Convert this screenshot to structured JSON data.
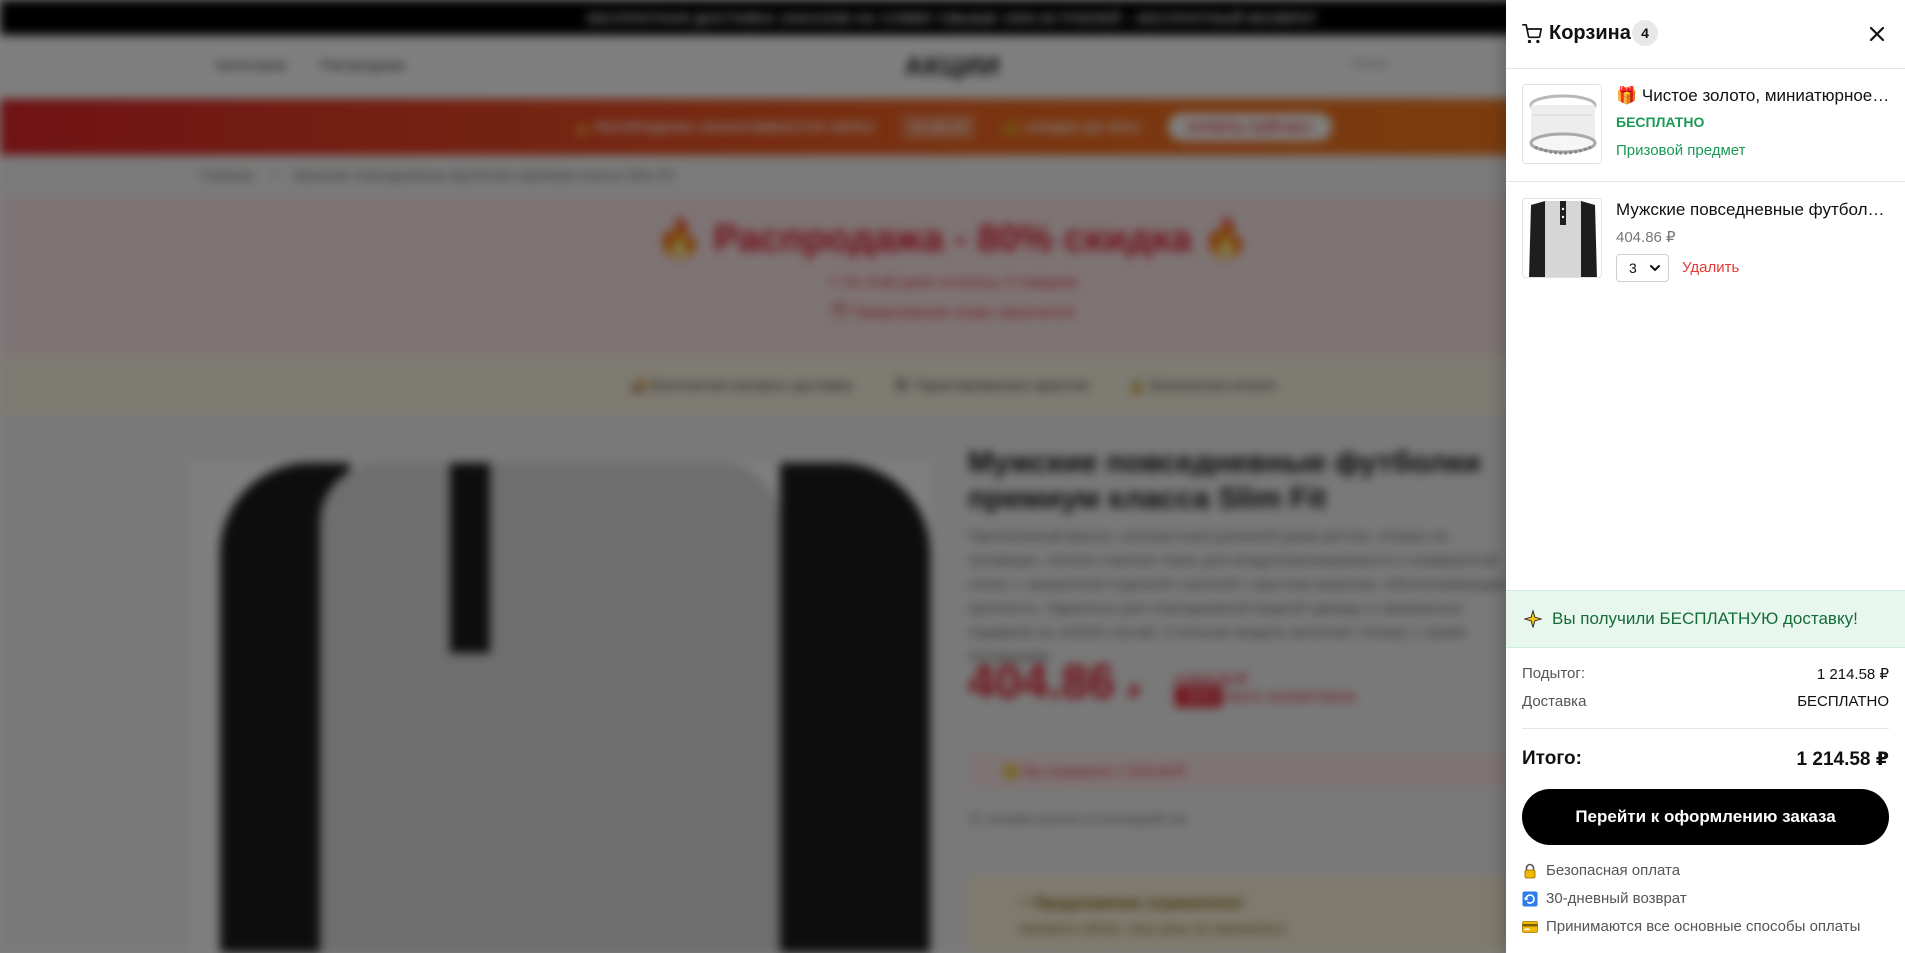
{
  "background": {
    "topbar_text": "БЕСПЛАТНАЯ ДОСТАВКА ЗАКАЗОВ НА СУММУ СВЫШЕ 1500.00 РУБЛЕЙ – БЕСПЛАТНЫЙ ВОЗВРАТ",
    "nav": {
      "categories": "Категории",
      "sales": "Распродажи",
      "logo": "АКЦИИ",
      "search": "Поиск"
    },
    "promo": {
      "ends": "🔥 РАСПРОДАЖА ЗАКАНЧИВАЕТСЯ ЧЕРЕЗ",
      "timer": "11:39:18",
      "discount": "💰 СКИДКИ ДО 80%!",
      "cta": "КУПИТЬ СЕЙЧАС!"
    },
    "breadcrumb": {
      "home": "Главная",
      "sep": "/",
      "current": "Мужские повседневные футболки премиум класса Slim Fit"
    },
    "sale": {
      "heading": "🔥 Распродажа - 80% скидка 🔥",
      "line1": "⚡ По этой цене осталось 5 товаров!",
      "line2": "⏰ Предложение скоро закончится"
    },
    "benefits": [
      "🚚 Бесплатная экспресс доставка",
      "🛡 Гарантированная гарантия",
      "🔒 Безопасная оплата"
    ],
    "product": {
      "title": "Мужские повседневные футболки премиум класса Slim Fit",
      "desc": "Приталенный фасон, контрастный длинный рукав реглан, планка на пуговицах, легкая и мягкая ткань для воздухопроницаемости и комфортной носки, с аккуратной отделкой строчкой с круглым вырезом, обеспечивающим прочность. Идеально для повседневной модной одежды и прекрасных подарков на любой случай. Стильная модель включает планку с тремя пуговицами.",
      "price": "404.86",
      "currency": "₽",
      "old_price": "2 024.32 ₽",
      "badge": "-80%",
      "stock": "мало экземпляров",
      "savings": "🪙 Вы сохраните 1 619.46 ₽",
      "viewers": "21 человек купили за последний час",
      "limited_title": "⚡ Предложение ограничено!",
      "limited_text": "Закажите сейчас, пока цены не изменились!"
    }
  },
  "cart": {
    "title": "Корзина",
    "count": "4",
    "items": [
      {
        "name": "🎁 Чистое золото, миниатюрное кольцо",
        "price_label": "БЕСПЛАТНО",
        "tag": "Призовой предмет"
      },
      {
        "name": "Мужские повседневные футболки премиум класса Slim Fit",
        "price": "404.86 ₽",
        "qty": "3",
        "remove_label": "Удалить"
      }
    ],
    "shipping_banner": "Вы получили БЕСПЛАТНУЮ доставку!",
    "subtotal_label": "Подытог:",
    "subtotal_value": "1 214.58 ₽",
    "delivery_label": "Доставка",
    "delivery_value": "БЕСПЛАТНО",
    "total_label": "Итого:",
    "total_value": "1 214.58 ₽",
    "checkout_label": "Перейти к оформлению заказа",
    "trust": [
      "Безопасная оплата",
      "30-дневный возврат",
      "Принимаются все основные способы оплаты"
    ]
  },
  "colors": {
    "accent": "#000000",
    "success": "#1a9a55",
    "danger": "#e53935",
    "sale_red": "#e11d2e"
  },
  "icons": {
    "cart": "cart-icon",
    "close": "close-icon",
    "truck": "sparkle-truck-icon",
    "lock": "lock-icon",
    "return": "return-icon",
    "card": "card-icon"
  }
}
